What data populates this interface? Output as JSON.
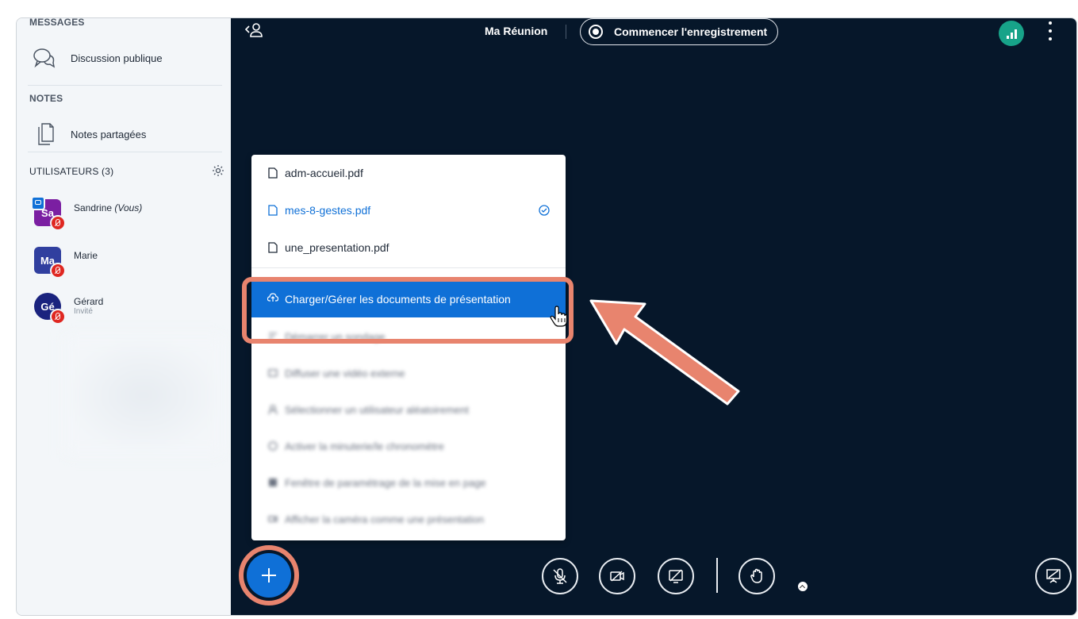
{
  "sidebar": {
    "messages_title": "MESSAGES",
    "public_chat": "Discussion publique",
    "notes_title": "NOTES",
    "shared_notes": "Notes partagées",
    "users_title": "UTILISATEURS (3)",
    "users": [
      {
        "initials": "Sa",
        "name": "Sandrine",
        "suffix": "(Vous)",
        "role": "",
        "color": "#7b1fa2"
      },
      {
        "initials": "Ma",
        "name": "Marie",
        "suffix": "",
        "role": "",
        "color": "#303f9f"
      },
      {
        "initials": "Gé",
        "name": "Gérard",
        "suffix": "",
        "role": "Invité",
        "color": "#1a237e"
      }
    ]
  },
  "header": {
    "meeting_title": "Ma Réunion",
    "record_label": "Commencer l'enregistrement"
  },
  "menu": {
    "files": [
      {
        "name": "adm-accueil.pdf",
        "selected": false
      },
      {
        "name": "mes-8-gestes.pdf",
        "selected": true
      },
      {
        "name": "une_presentation.pdf",
        "selected": false
      }
    ],
    "upload_label": "Charger/Gérer les documents de présentation",
    "actions": [
      "Démarrer un sondage",
      "Diffuser une vidéo externe",
      "Sélectionner un utilisateur aléatoirement",
      "Activer la minuterie/le chronomètre",
      "Fenêtre de paramétrage de la mise en page",
      "Afficher la caméra comme une présentation"
    ]
  },
  "colors": {
    "accent": "#0f70d7",
    "annotation": "#e8846e",
    "main_bg": "#06172a"
  }
}
